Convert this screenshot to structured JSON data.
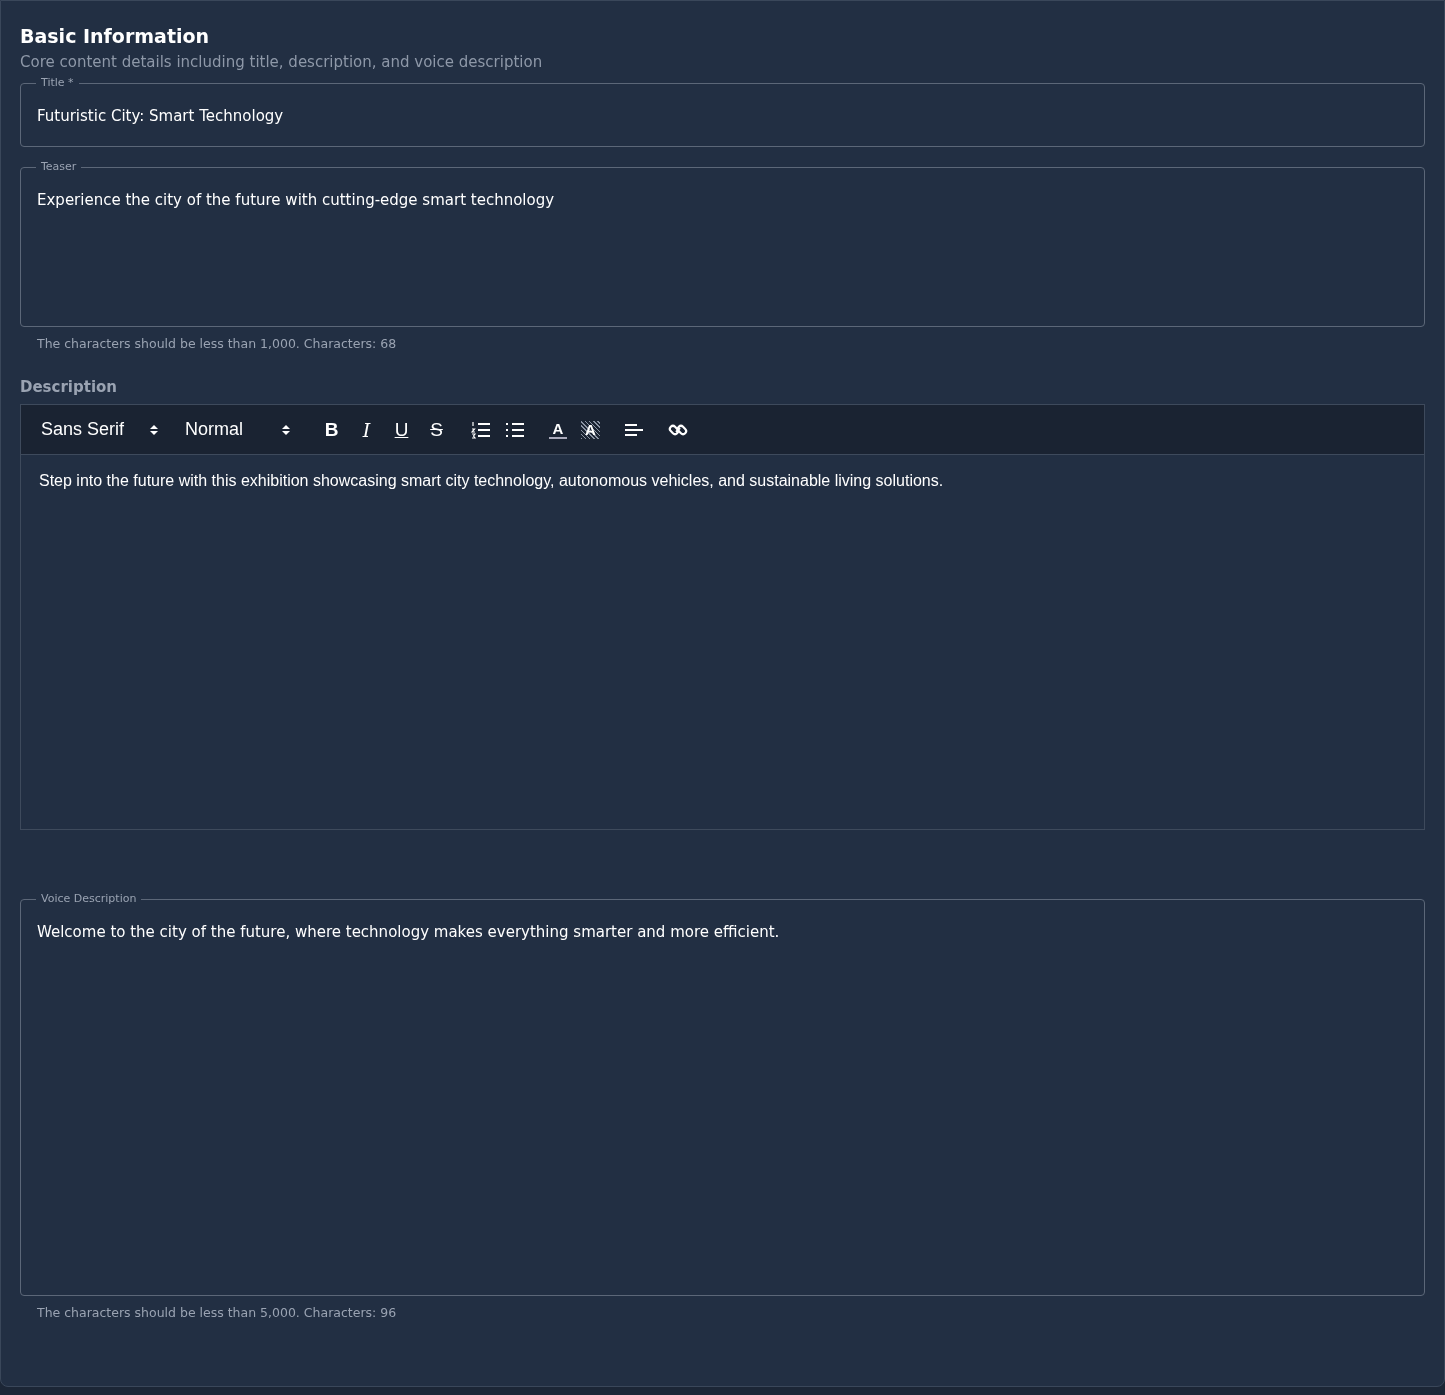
{
  "section": {
    "title": "Basic Information",
    "subtitle": "Core content details including title, description, and voice description"
  },
  "title_field": {
    "label": "Title *",
    "value": "Futuristic City: Smart Technology"
  },
  "teaser_field": {
    "label": "Teaser",
    "value": "Experience the city of the future with cutting-edge smart technology",
    "helper": "The characters should be less than 1,000. Characters: 68"
  },
  "description": {
    "label": "Description",
    "font_picker": "Sans Serif",
    "size_picker": "Normal",
    "tools": [
      {
        "kind": "bold",
        "label": "B"
      },
      {
        "kind": "italic",
        "label": "I"
      },
      {
        "kind": "underline",
        "label": "U"
      },
      {
        "kind": "strike",
        "label": "S"
      },
      {
        "kind": "ordered-list"
      },
      {
        "kind": "bullet-list"
      },
      {
        "kind": "text-color",
        "label": "A"
      },
      {
        "kind": "highlight",
        "label": "A"
      },
      {
        "kind": "align"
      },
      {
        "kind": "link"
      }
    ],
    "content": "Step into the future with this exhibition showcasing smart city technology, autonomous vehicles, and sustainable living solutions."
  },
  "voice_field": {
    "label": "Voice Description",
    "value": "Welcome to the city of the future, where technology makes everything smarter and more efficient.",
    "helper": "The characters should be less than 5,000. Characters: 96"
  }
}
